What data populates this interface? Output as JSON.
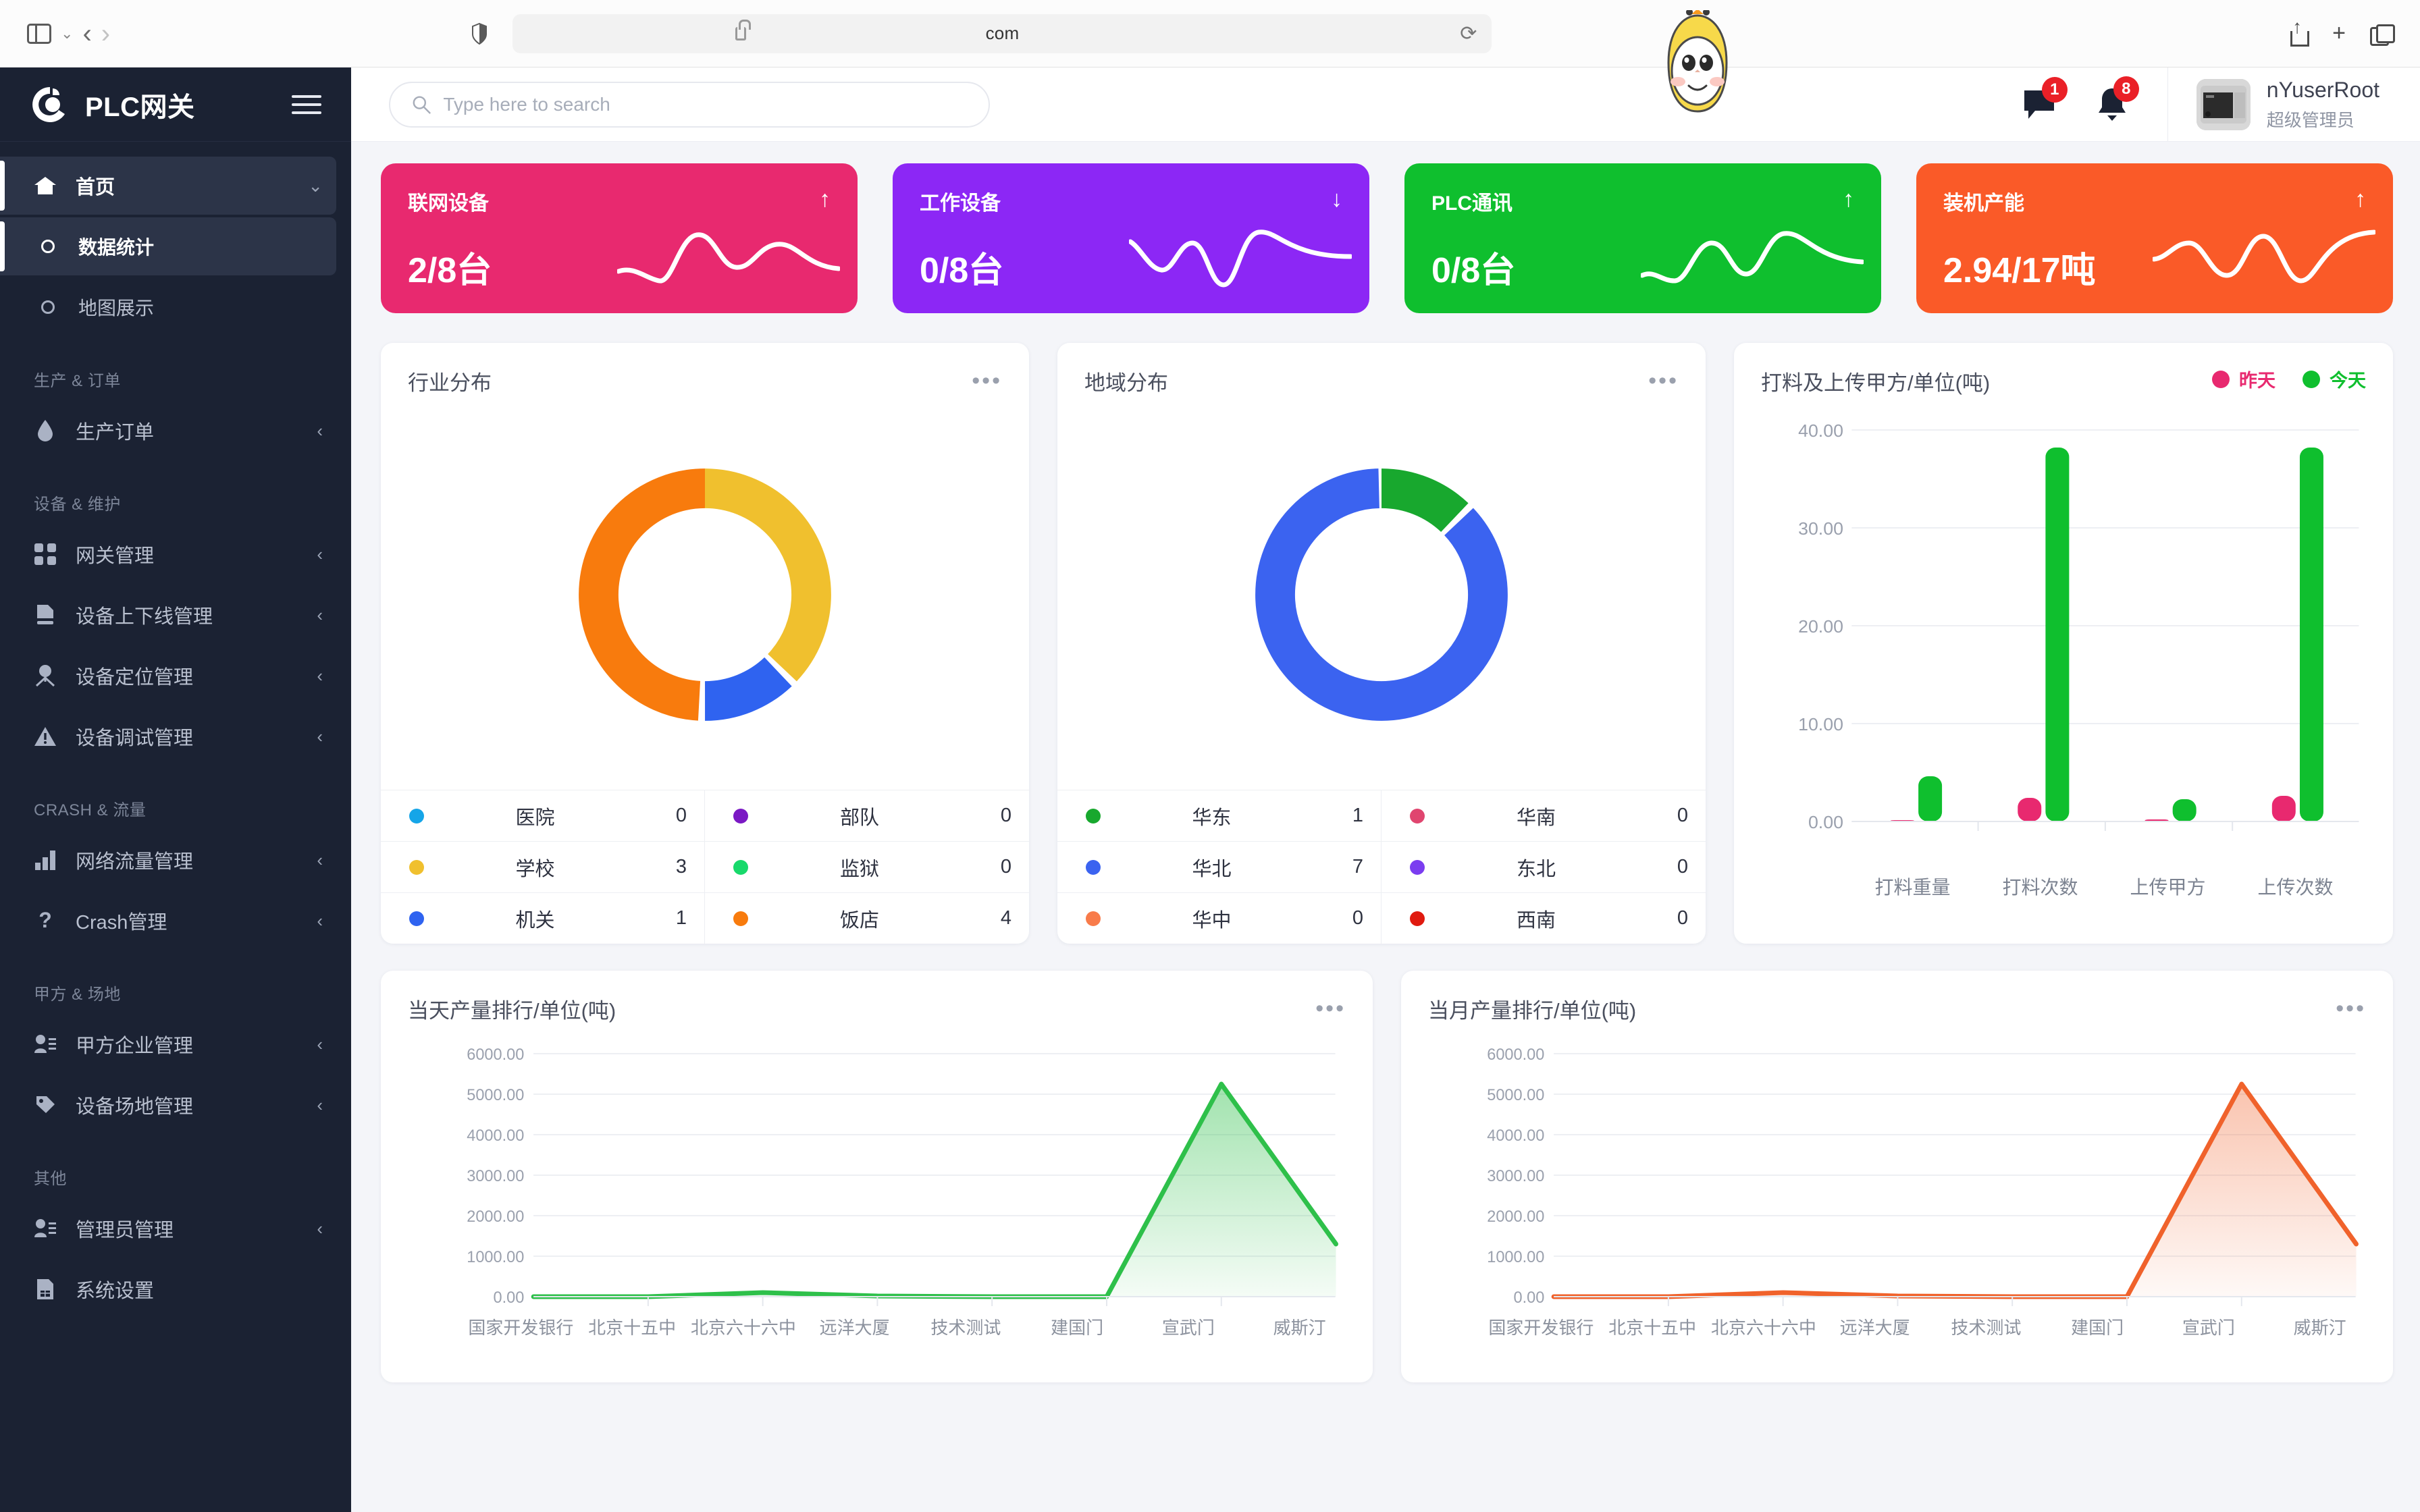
{
  "browser": {
    "url_text": "com",
    "sidebar_toggle": "sidebar-toggle",
    "back": "‹",
    "forward": "›",
    "reload": "⟳",
    "new_tab": "+",
    "chev": "⌄"
  },
  "sidebar": {
    "brand": "PLC网关",
    "items": [
      {
        "label": "首页",
        "icon": "home-icon",
        "active": true,
        "chevron": "⌄",
        "type": "parent"
      },
      {
        "label": "数据统计",
        "icon": "circle-icon",
        "active": true,
        "type": "sub"
      },
      {
        "label": "地图展示",
        "icon": "circle-icon",
        "active": false,
        "type": "sub"
      }
    ],
    "groups": [
      {
        "title": "生产 & 订单",
        "items": [
          {
            "label": "生产订单",
            "icon": "droplet-icon",
            "chevron": "‹"
          }
        ]
      },
      {
        "title": "设备 & 维护",
        "items": [
          {
            "label": "网关管理",
            "icon": "grid-icon",
            "chevron": "‹"
          },
          {
            "label": "设备上下线管理",
            "icon": "document-icon",
            "chevron": "‹"
          },
          {
            "label": "设备定位管理",
            "icon": "location-pin-icon",
            "chevron": "‹"
          },
          {
            "label": "设备调试管理",
            "icon": "warning-triangle-icon",
            "chevron": "‹"
          }
        ]
      },
      {
        "title": "CRASH & 流量",
        "items": [
          {
            "label": "网络流量管理",
            "icon": "bar-chart-icon",
            "chevron": "‹"
          },
          {
            "label": "Crash管理",
            "icon": "question-mark-icon",
            "chevron": "‹"
          }
        ]
      },
      {
        "title": "甲方 & 场地",
        "items": [
          {
            "label": "甲方企业管理",
            "icon": "user-list-icon",
            "chevron": "‹"
          },
          {
            "label": "设备场地管理",
            "icon": "tag-icon",
            "chevron": "‹"
          }
        ]
      },
      {
        "title": "其他",
        "items": [
          {
            "label": "管理员管理",
            "icon": "user-list-icon",
            "chevron": "‹"
          },
          {
            "label": "系统设置",
            "icon": "sim-card-icon",
            "chevron": ""
          }
        ]
      }
    ]
  },
  "topbar": {
    "search_placeholder": "Type here to search",
    "search_value": "",
    "message_badge": "1",
    "bell_badge": "8",
    "user_name": "nYuserRoot",
    "user_role": "超级管理员"
  },
  "kpi_cards": [
    {
      "label": "联网设备",
      "value": "2/8台",
      "arrow": "↑",
      "color": "#e8296f"
    },
    {
      "label": "工作设备",
      "value": "0/8台",
      "arrow": "↓",
      "color": "#8c27f5"
    },
    {
      "label": "PLC通讯",
      "value": "0/8台",
      "arrow": "↑",
      "color": "#0fbf2e"
    },
    {
      "label": "装机产能",
      "value": "2.94/17吨",
      "arrow": "↑",
      "color": "#fa5a28"
    }
  ],
  "industry_card": {
    "title": "行业分布",
    "menu": "•••"
  },
  "region_card": {
    "title": "地域分布",
    "menu": "•••"
  },
  "day_card": {
    "title": "当天产量排行/单位(吨)",
    "menu": "•••"
  },
  "month_card": {
    "title": "当月产量排行/单位(吨)",
    "menu": "•••"
  },
  "upload_card": {
    "title": "打料及上传甲方/单位(吨)",
    "legend": [
      {
        "name": "昨天",
        "color": "#e8296f"
      },
      {
        "name": "今天",
        "color": "#0fbf2e"
      }
    ]
  },
  "chart_data": [
    {
      "type": "pie",
      "id": "industry-distribution",
      "title": "行业分布",
      "legend_position": "bottom",
      "labels": [
        "医院",
        "学校",
        "机关",
        "部队",
        "监狱",
        "饭店"
      ],
      "values": [
        0,
        3,
        1,
        0,
        0,
        4
      ],
      "colors": [
        "#15a5e8",
        "#f0c02e",
        "#2f63f0",
        "#7b19c4",
        "#18d96b",
        "#f87b0d"
      ]
    },
    {
      "type": "pie",
      "id": "region-distribution",
      "title": "地域分布",
      "legend_position": "bottom",
      "labels": [
        "华东",
        "华北",
        "华中",
        "华南",
        "东北",
        "西南"
      ],
      "values": [
        1,
        7,
        0,
        0,
        0,
        0
      ],
      "colors": [
        "#18a82e",
        "#3b63f0",
        "#f87b4a",
        "#e0456f",
        "#7b3df0",
        "#e01a0f"
      ]
    },
    {
      "type": "bar",
      "id": "upload-bar",
      "title": "打料及上传甲方/单位(吨)",
      "categories": [
        "打料重量",
        "打料次数",
        "上传甲方",
        "上传次数"
      ],
      "series": [
        {
          "name": "昨天",
          "color": "#e8296f",
          "values": [
            0.15,
            2.4,
            0.2,
            2.6
          ]
        },
        {
          "name": "今天",
          "color": "#0fbf2e",
          "values": [
            4.6,
            38.2,
            2.3,
            38.2
          ]
        }
      ],
      "ylim": [
        0,
        40
      ],
      "yticks": [
        0,
        10,
        20,
        30,
        40
      ],
      "ytick_labels": [
        "0.00",
        "10.00",
        "20.00",
        "30.00",
        "40.00"
      ],
      "grid": true,
      "legend_position": "top-right"
    },
    {
      "type": "area",
      "id": "day-production",
      "title": "当天产量排行/单位(吨)",
      "categories": [
        "国家开发银行",
        "北京十五中",
        "北京六十六中",
        "远洋大厦",
        "技术测试",
        "建国门",
        "宣武门",
        "威斯汀"
      ],
      "values": [
        0,
        0,
        95,
        10,
        0,
        0,
        5250,
        1300
      ],
      "color": "#2ec04a",
      "ylim": [
        0,
        6000
      ],
      "yticks": [
        0,
        1000,
        2000,
        3000,
        4000,
        5000,
        6000
      ],
      "ytick_labels": [
        "0.00",
        "1000.00",
        "2000.00",
        "3000.00",
        "4000.00",
        "5000.00",
        "6000.00"
      ],
      "grid": true
    },
    {
      "type": "area",
      "id": "month-production",
      "title": "当月产量排行/单位(吨)",
      "categories": [
        "国家开发银行",
        "北京十五中",
        "北京六十六中",
        "远洋大厦",
        "技术测试",
        "建国门",
        "宣武门",
        "威斯汀"
      ],
      "values": [
        0,
        0,
        95,
        10,
        0,
        0,
        5250,
        1300
      ],
      "color": "#f0622b",
      "ylim": [
        0,
        6000
      ],
      "yticks": [
        0,
        1000,
        2000,
        3000,
        4000,
        5000,
        6000
      ],
      "ytick_labels": [
        "0.00",
        "1000.00",
        "2000.00",
        "3000.00",
        "4000.00",
        "5000.00",
        "6000.00"
      ],
      "grid": true
    }
  ]
}
